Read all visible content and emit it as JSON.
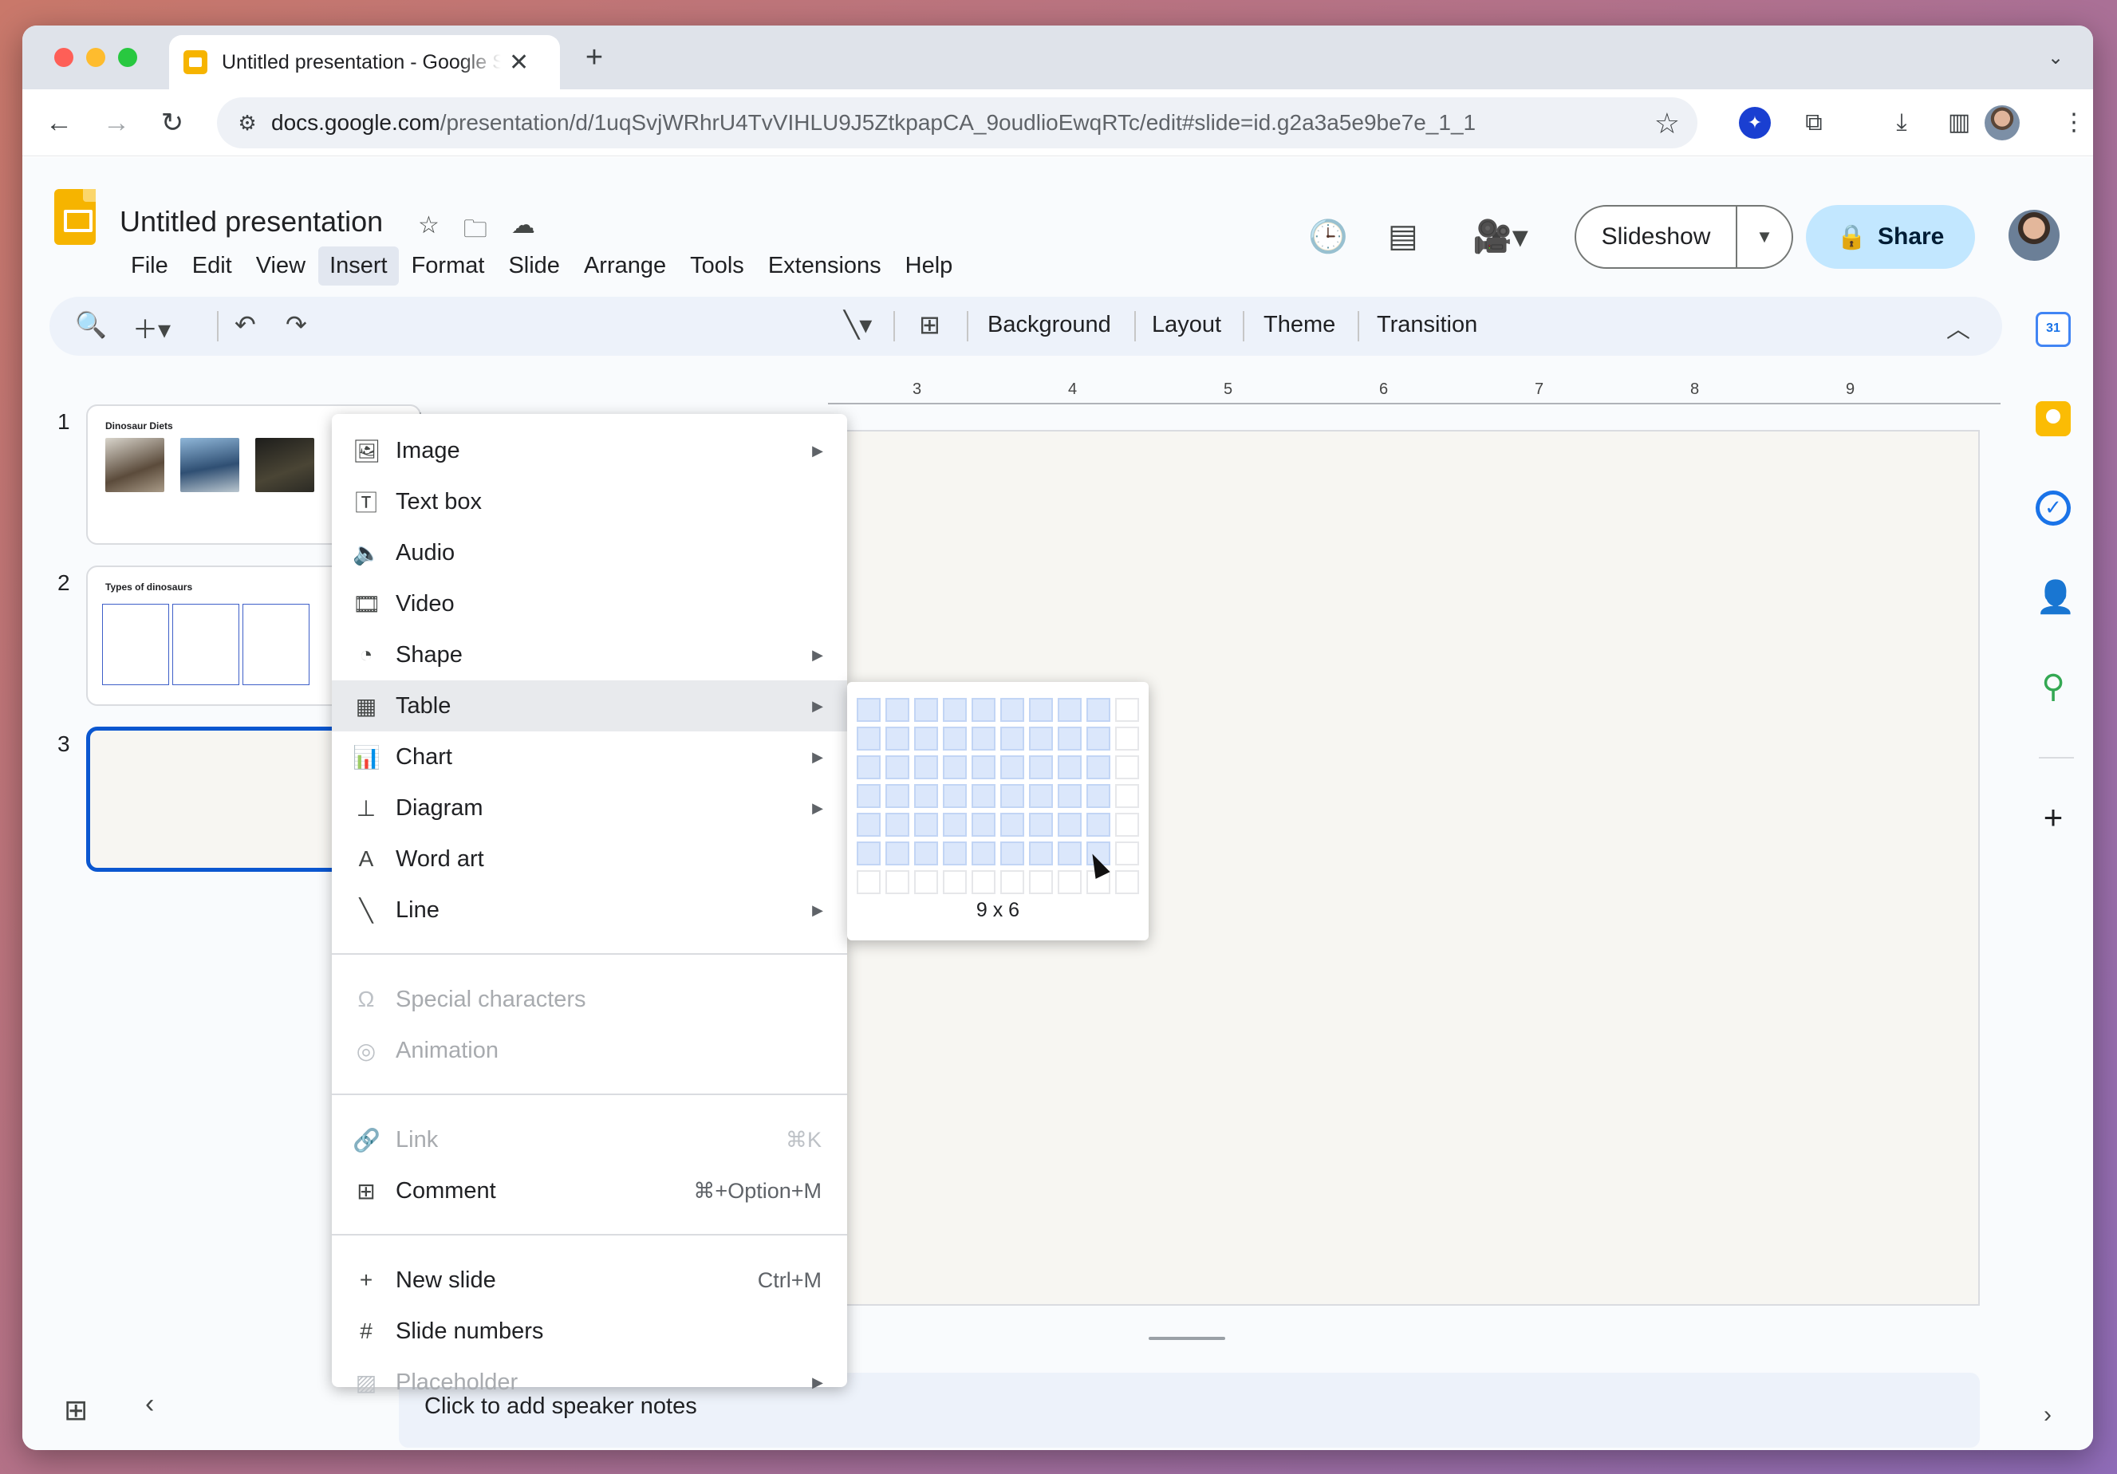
{
  "browser": {
    "tab_title": "Untitled presentation - Google Slides",
    "tab_close": "✕",
    "new_tab": "+",
    "url_host": "docs.google.com",
    "url_path": "/presentation/d/1uqSvjWRhrU4TvVIHLU9J5ZtkpapCA_9oudlioEwqRTc/edit#slide=id.g2a3a5e9be7e_1_1"
  },
  "header": {
    "doc_title": "Untitled presentation",
    "menu": [
      "File",
      "Edit",
      "View",
      "Insert",
      "Format",
      "Slide",
      "Arrange",
      "Tools",
      "Extensions",
      "Help"
    ],
    "active_menu": "Insert",
    "slideshow_label": "Slideshow",
    "share_label": "Share"
  },
  "toolbar": {
    "background": "Background",
    "layout": "Layout",
    "theme": "Theme",
    "transition": "Transition"
  },
  "filmstrip": {
    "slides": [
      {
        "number": "1",
        "title": "Dinosaur Diets"
      },
      {
        "number": "2",
        "title": "Types of dinosaurs"
      },
      {
        "number": "3",
        "title": ""
      }
    ],
    "selected": 3
  },
  "ruler": {
    "labels": [
      "3",
      "4",
      "5",
      "6",
      "7",
      "8",
      "9"
    ]
  },
  "speaker_notes": {
    "placeholder": "Click to add speaker notes"
  },
  "insert_menu": {
    "items": [
      {
        "label": "Image",
        "icon": "image-icon",
        "submenu": true
      },
      {
        "label": "Text box",
        "icon": "text-box-icon"
      },
      {
        "label": "Audio",
        "icon": "audio-icon"
      },
      {
        "label": "Video",
        "icon": "video-icon"
      },
      {
        "label": "Shape",
        "icon": "shape-icon",
        "submenu": true
      },
      {
        "label": "Table",
        "icon": "table-icon",
        "submenu": true,
        "hover": true
      },
      {
        "label": "Chart",
        "icon": "chart-icon",
        "submenu": true
      },
      {
        "label": "Diagram",
        "icon": "diagram-icon",
        "submenu": true
      },
      {
        "label": "Word art",
        "icon": "word-art-icon"
      },
      {
        "label": "Line",
        "icon": "line-icon",
        "submenu": true
      },
      {
        "label": "Special characters",
        "icon": "omega-icon",
        "disabled": true
      },
      {
        "label": "Animation",
        "icon": "animation-icon",
        "disabled": true
      },
      {
        "label": "Link",
        "icon": "link-icon",
        "disabled": true,
        "shortcut": "⌘K"
      },
      {
        "label": "Comment",
        "icon": "comment-icon",
        "shortcut": "⌘+Option+M"
      },
      {
        "label": "New slide",
        "icon": "plus-icon",
        "shortcut": "Ctrl+M"
      },
      {
        "label": "Slide numbers",
        "icon": "hash-icon"
      },
      {
        "label": "Placeholder",
        "icon": "placeholder-icon",
        "disabled": true,
        "submenu": true
      }
    ]
  },
  "table_picker": {
    "columns": 10,
    "rows": 7,
    "selected_cols": 9,
    "selected_rows": 6,
    "label": "9 x 6"
  },
  "side_panel": {
    "calendar_day": "31"
  },
  "colors": {
    "accent": "#0b57d0",
    "share_bg": "#c2e7ff",
    "slides_yellow": "#f6b400",
    "picker_selected": "#dbe7fb"
  }
}
